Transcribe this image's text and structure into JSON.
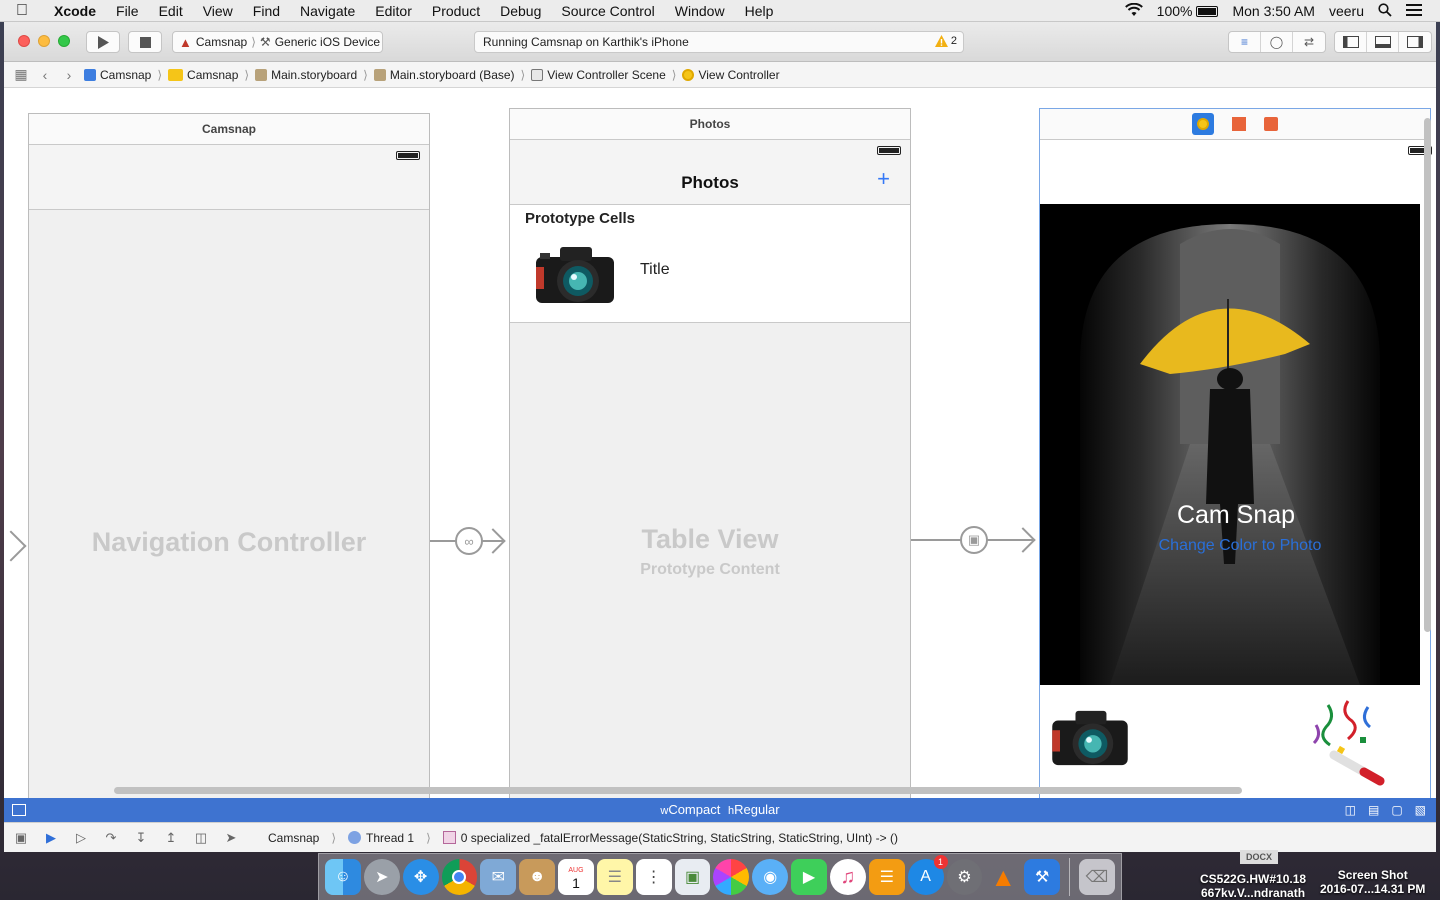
{
  "menubar": {
    "app_name": "Xcode",
    "menus": [
      "File",
      "Edit",
      "View",
      "Find",
      "Navigate",
      "Editor",
      "Product",
      "Debug",
      "Source Control",
      "Window",
      "Help"
    ],
    "battery": "100%",
    "clock": "Mon 3:50 AM",
    "user": "veeru"
  },
  "toolbar": {
    "scheme": "Camsnap",
    "device": "Generic iOS Device",
    "activity": "Running Camsnap on Karthik's iPhone",
    "warning_count": "2"
  },
  "jumpbar": {
    "items": [
      "Camsnap",
      "Camsnap",
      "Main.storyboard",
      "Main.storyboard (Base)",
      "View Controller Scene",
      "View Controller"
    ]
  },
  "scenes": {
    "nav": {
      "title": "Camsnap",
      "placeholder": "Navigation Controller"
    },
    "photos": {
      "title": "Photos",
      "nav_title": "Photos",
      "add_glyph": "+",
      "section": "Prototype Cells",
      "cell_title": "Title",
      "placeholder": "Table View",
      "placeholder_sub": "Prototype Content"
    },
    "vc": {
      "heading": "Cam Snap",
      "button_label": "Change Color to Photo"
    }
  },
  "sizeclass": {
    "w": "Compact",
    "h": "Regular"
  },
  "debug": {
    "target": "Camsnap",
    "thread": "Thread 1",
    "frame": "0 specialized _fatalErrorMessage(StaticString, StaticString, StaticString, UInt) -> ()"
  },
  "dock": {
    "apps": [
      "finder-icon",
      "launchpad-icon",
      "safari-icon",
      "chrome-icon",
      "preview-icon",
      "contacts-icon",
      "calendar-icon",
      "notes-icon",
      "reminders-icon",
      "photos-icon",
      "messages-icon",
      "facetime-icon",
      "itunes-icon",
      "ibooks-icon",
      "appstore-icon",
      "system-preferences-icon",
      "vlc-icon",
      "xcode-icon",
      "trash-icon"
    ],
    "calendar_month": "AUG",
    "calendar_day": "1",
    "appstore_badge": "1"
  },
  "desktop": {
    "file1_line1": "CS522G.HW#10.18",
    "file1_line2": "667kv.V...ndranath",
    "file2_line1": "Screen Shot",
    "file2_line2": "2016-07...14.31 PM",
    "docx_label": "DOCX"
  },
  "colors": {
    "accent": "#3e73d0",
    "tint": "#3478f6",
    "umbrella": "#e8b91e"
  }
}
